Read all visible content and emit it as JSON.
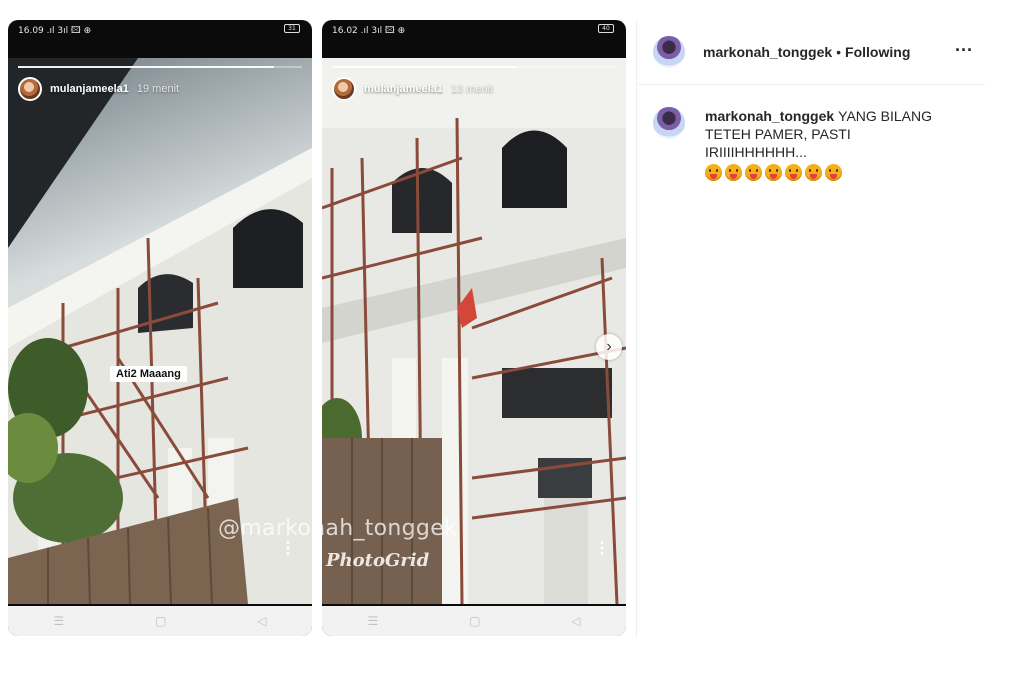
{
  "left_story": {
    "status": "16.09 .ıl 3ıl 🖾 ⊕",
    "battery": "31",
    "username": "mulanjameela1",
    "time": "19 menit",
    "sticker": "Ati2 Maaang",
    "progress": 0.9
  },
  "right_story": {
    "status": "16.02 .ıl 3ıl 🖾 ⊕",
    "battery": "40",
    "username": "mulanjameela1",
    "time": "13 menit",
    "progress": 0.65
  },
  "overlay": {
    "watermark": "@markonah_tonggek",
    "photogrid": "PhotoGrid"
  },
  "android_nav": [
    "☰",
    "▢",
    "◁"
  ],
  "post": {
    "username": "markonah_tonggek",
    "separator": "•",
    "follow_status": "Following",
    "more": "···",
    "comment_user": "markonah_tonggek",
    "comment_text": "YANG BILANG TETEH PAMER, PASTI IRIIIIHHHHHH...",
    "emoji_count": 7
  },
  "icons": {
    "next": "chevron-right-icon",
    "more": "more-options-icon"
  },
  "colors": {
    "text": "#262626",
    "border": "#efefef",
    "emoji": "#f2b01e"
  }
}
